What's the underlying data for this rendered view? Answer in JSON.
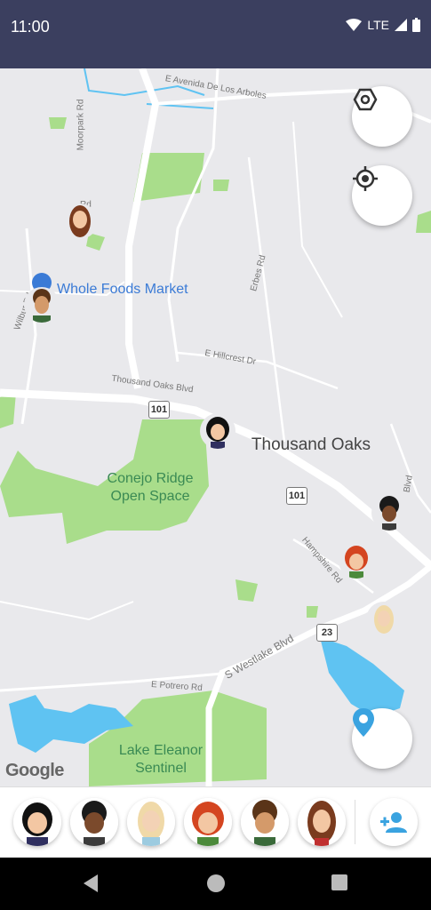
{
  "status_bar": {
    "time": "11:00",
    "network": "LTE",
    "icons": [
      "wifi-icon",
      "signal-icon",
      "battery-icon"
    ]
  },
  "map": {
    "poi": "Whole Foods Market",
    "city": "Thousand Oaks",
    "parks": [
      "Conejo Ridge Open Space",
      "Lake Eleanor Sentinel"
    ],
    "roads": [
      "E Avenida De Los Arboles",
      "Moorpark Rd",
      "Erbes Rd",
      "E Hillcrest Dr",
      "Thousand Oaks Blvd",
      "Hampshire Rd",
      "S Westlake Blvd",
      "E Potrero Rd",
      "Wilbur Rd",
      "Rd",
      "Blvd"
    ],
    "highway_shields": [
      "101",
      "101",
      "23"
    ],
    "attribution": "Google",
    "colors": {
      "water": "#5fc3f2",
      "park": "#a9dd8b",
      "road": "#ffffff",
      "land": "#e9e9ec"
    }
  },
  "map_controls": {
    "icons": [
      "compass-icon",
      "my-location-icon",
      "location-pin-icon"
    ]
  },
  "friends": [
    {
      "name": "friend-1",
      "hair": "#111111",
      "skin": "#f3c7a3",
      "shirt": "#2f2f5f"
    },
    {
      "name": "friend-2",
      "hair": "#1a1a1a",
      "skin": "#7b4a2c",
      "shirt": "#3b3b3b"
    },
    {
      "name": "friend-3",
      "hair": "#f0d9a8",
      "skin": "#f3d2b5",
      "shirt": "#9ccbe0"
    },
    {
      "name": "friend-4",
      "hair": "#d44520",
      "skin": "#f3c7a3",
      "shirt": "#4c8a3b"
    },
    {
      "name": "friend-5",
      "hair": "#5a3418",
      "skin": "#d49a6a",
      "shirt": "#3a6a3a"
    },
    {
      "name": "friend-6",
      "hair": "#7a3b1e",
      "skin": "#f3c7a3",
      "shirt": "#c03030"
    }
  ],
  "add_friend": {
    "icon": "add-person-icon",
    "accent": "#3aa3e0"
  },
  "nav": {
    "icons": [
      "back-icon",
      "home-icon",
      "recents-icon"
    ]
  }
}
